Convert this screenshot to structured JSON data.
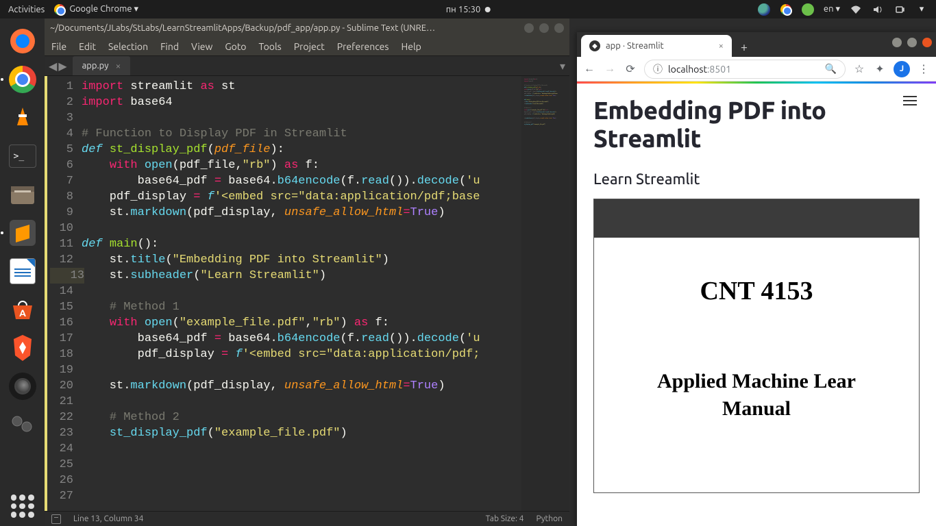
{
  "gnome": {
    "activities": "Activities",
    "app": "Google Chrome ▾",
    "clock": "пн 15:30",
    "lang": "en ▾"
  },
  "sublime": {
    "title": "~/Documents/JLabs/StLabs/LearnStreamlitApps/Backup/pdf_app/app.py - Sublime Text (UNRE…",
    "menu": [
      "File",
      "Edit",
      "Selection",
      "Find",
      "View",
      "Goto",
      "Tools",
      "Project",
      "Preferences",
      "Help"
    ],
    "tab": "app.py",
    "status_left": "Line 13, Column 34",
    "status_tab": "Tab Size: 4",
    "status_lang": "Python",
    "code": [
      {
        "n": 1,
        "h": "<span class='kw'>import</span> streamlit <span class='kw'>as</span> st"
      },
      {
        "n": 2,
        "h": "<span class='kw'>import</span> base64"
      },
      {
        "n": 3,
        "h": ""
      },
      {
        "n": 4,
        "h": "<span class='com'># Function to Display PDF in Streamlit</span>"
      },
      {
        "n": 5,
        "h": "<span class='def'>def</span> <span class='fn'>st_display_pdf</span>(<span class='par'>pdf_file</span>):"
      },
      {
        "n": 6,
        "h": "    <span class='kw'>with</span> <span class='fn2'>open</span>(pdf_file,<span class='str'>\"rb\"</span>) <span class='kw'>as</span> f:"
      },
      {
        "n": 7,
        "h": "        base64_pdf <span class='kw'>=</span> base64.<span class='fn2'>b64encode</span>(f.<span class='fn2'>read</span>()).<span class='fn2'>decode</span>(<span class='str'>'u</span>"
      },
      {
        "n": 8,
        "h": "    pdf_display <span class='kw'>=</span> <span class='def'>f</span><span class='str'>'&lt;embed src=\"data:application/pdf;base</span>"
      },
      {
        "n": 9,
        "h": "    st.<span class='fn2'>markdown</span>(pdf_display, <span class='par'>unsafe_allow_html</span><span class='kw'>=</span><span class='bool'>True</span>)"
      },
      {
        "n": 10,
        "h": ""
      },
      {
        "n": 11,
        "h": "<span class='def'>def</span> <span class='fn'>main</span>():"
      },
      {
        "n": 12,
        "h": "    st.<span class='fn2'>title</span>(<span class='str'>\"Embedding PDF into Streamlit\"</span>)"
      },
      {
        "n": 13,
        "h": "    st.<span class='fn2'>subheader</span>(<span class='str'>\"Learn Streamlit\"</span>)"
      },
      {
        "n": 14,
        "h": ""
      },
      {
        "n": 15,
        "h": "    <span class='com'># Method 1</span>"
      },
      {
        "n": 16,
        "h": "    <span class='kw'>with</span> <span class='fn2'>open</span>(<span class='str'>\"example_file.pdf\"</span>,<span class='str'>\"rb\"</span>) <span class='kw'>as</span> f:"
      },
      {
        "n": 17,
        "h": "        base64_pdf <span class='kw'>=</span> base64.<span class='fn2'>b64encode</span>(f.<span class='fn2'>read</span>()).<span class='fn2'>decode</span>(<span class='str'>'u</span>"
      },
      {
        "n": 18,
        "h": "        pdf_display <span class='kw'>=</span> <span class='def'>f</span><span class='str'>'&lt;embed src=\"data:application/pdf;</span>"
      },
      {
        "n": 19,
        "h": ""
      },
      {
        "n": 20,
        "h": "    st.<span class='fn2'>markdown</span>(pdf_display, <span class='par'>unsafe_allow_html</span><span class='kw'>=</span><span class='bool'>True</span>)"
      },
      {
        "n": 21,
        "h": ""
      },
      {
        "n": 22,
        "h": "    <span class='com'># Method 2</span>"
      },
      {
        "n": 23,
        "h": "    <span class='fn2'>st_display_pdf</span>(<span class='str'>\"example_file.pdf\"</span>)"
      },
      {
        "n": 24,
        "h": ""
      },
      {
        "n": 25,
        "h": ""
      },
      {
        "n": 26,
        "h": ""
      },
      {
        "n": 27,
        "h": ""
      }
    ]
  },
  "chrome": {
    "tab_title": "app · Streamlit",
    "url_host": "localhost",
    "url_port": ":8501",
    "page": {
      "title": "Embedding PDF into Streamlit",
      "subheader": "Learn Streamlit",
      "pdf": {
        "line1": "CNT 4153",
        "line2": "Applied Machine Lear",
        "line3": "Manual"
      }
    }
  }
}
